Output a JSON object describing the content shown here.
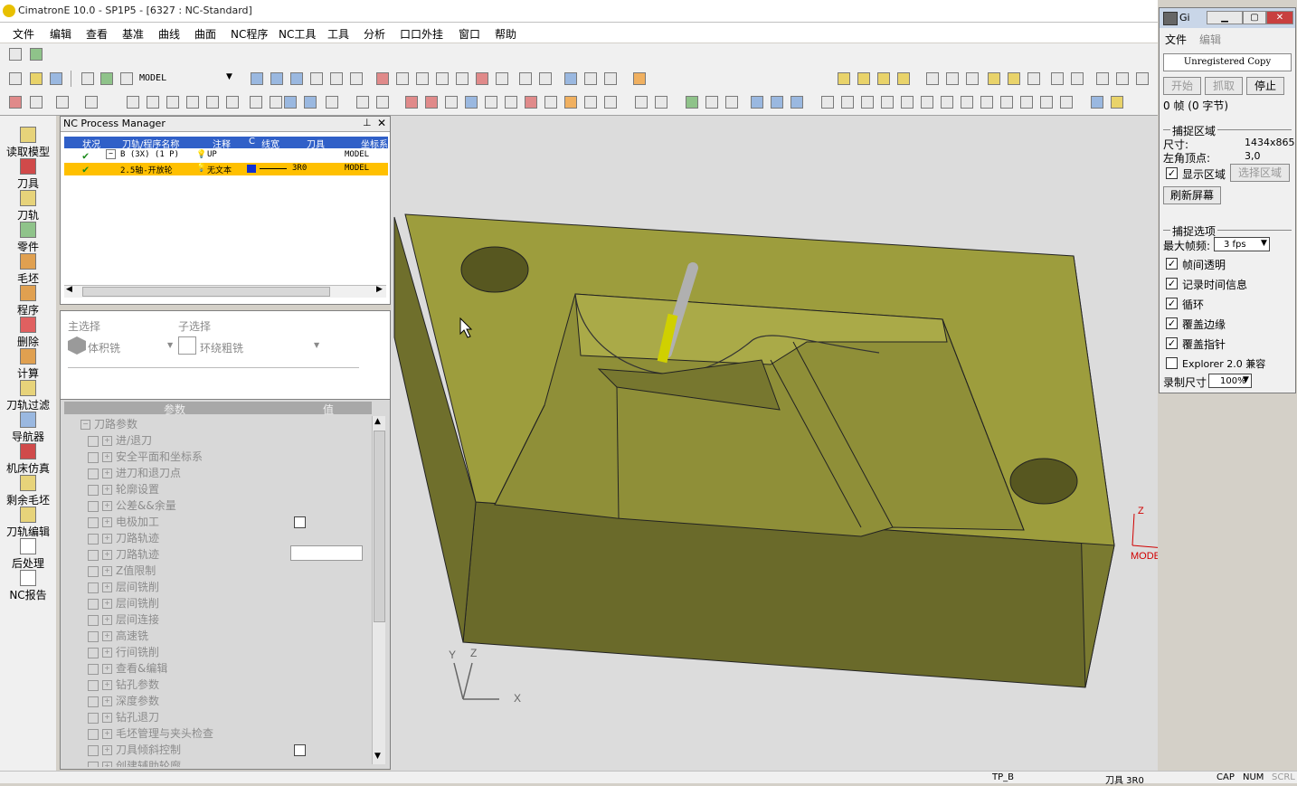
{
  "window": {
    "title": "CimatronE 10.0 - SP1P5 - [6327 : NC-Standard]"
  },
  "menu": [
    "文件",
    "编辑",
    "查看",
    "基准",
    "曲线",
    "曲面",
    "NC程序",
    "NC工具",
    "工具",
    "分析",
    "口口外挂",
    "窗口",
    "帮助"
  ],
  "toolbar": {
    "model_label": "MODEL"
  },
  "left_toolbar": [
    "读取模型",
    "刀具",
    "刀轨",
    "零件",
    "毛坯",
    "程序",
    "删除",
    "计算",
    "刀轨过滤",
    "导航器",
    "机床仿真",
    "剩余毛坯",
    "刀轨编辑",
    "后处理",
    "NC报告"
  ],
  "nc_manager": {
    "title": "NC Process Manager",
    "columns": [
      "状况",
      "刀轨/程序名称",
      "注释",
      "C",
      "线宽",
      "刀具",
      "坐标系"
    ],
    "rows": [
      {
        "name": "B (3X) (1 P)",
        "comment": "UP",
        "tool": "",
        "coord": "MODEL"
      },
      {
        "name": "2.5轴-开放轮",
        "comment": "无文本",
        "tool": "3R0",
        "coord": "MODEL"
      }
    ]
  },
  "selection": {
    "main_label": "主选择",
    "main_value": "体积铣",
    "sub_label": "子选择",
    "sub_value": "环绕粗铣"
  },
  "params": {
    "header_param": "参数",
    "header_value": "值",
    "root": "刀路参数",
    "items": [
      "进/退刀",
      "安全平面和坐标系",
      "进刀和退刀点",
      "轮廓设置",
      "公差&&余量",
      "电极加工",
      "刀路轨迹",
      "刀路轨迹",
      "Z值限制",
      "层间铣削",
      "层间铣削",
      "层间连接",
      "高速铣",
      "行间铣削",
      "查看&编辑",
      "钻孔参数",
      "深度参数",
      "钻孔退刀",
      "毛坯管理与夹头检查",
      "刀具倾斜控制",
      "创建辅助轮廓"
    ]
  },
  "viewport": {
    "axis_model": {
      "x": "X",
      "z": "Z",
      "label": "MODEL"
    },
    "axis_triad": {
      "x": "X",
      "y": "Y",
      "z": "Z"
    }
  },
  "statusbar": {
    "tp": "TP_B",
    "tool": "刀具 3R0",
    "cap": "CAP",
    "num": "NUM",
    "scrl": "SCRL"
  },
  "gif_recorder": {
    "title": "Gi",
    "menu": [
      "文件",
      "编辑"
    ],
    "banner": "Unregistered Copy",
    "buttons": {
      "start": "开始",
      "capture": "抓取",
      "stop": "停止"
    },
    "status": "0 帧 (0 字节)",
    "capture_area": {
      "section": "捕捉区域",
      "size_label": "尺寸:",
      "size_value": "1434x865",
      "corner_label": "左角顶点:",
      "corner_value": "3,0",
      "show_area": "显示区域",
      "select_area": "选择区域",
      "refresh": "刷新屏幕"
    },
    "capture_options": {
      "section": "捕捉选项",
      "max_fps_label": "最大帧频:",
      "max_fps_value": "3 fps",
      "options": [
        {
          "label": "帧间透明",
          "checked": true
        },
        {
          "label": "记录时间信息",
          "checked": true
        },
        {
          "label": "循环",
          "checked": true
        },
        {
          "label": "覆盖边缘",
          "checked": true
        },
        {
          "label": "覆盖指针",
          "checked": true
        },
        {
          "label": "Explorer 2.0 兼容",
          "checked": false
        }
      ],
      "record_size_label": "录制尺寸",
      "record_size_value": "100%"
    }
  }
}
